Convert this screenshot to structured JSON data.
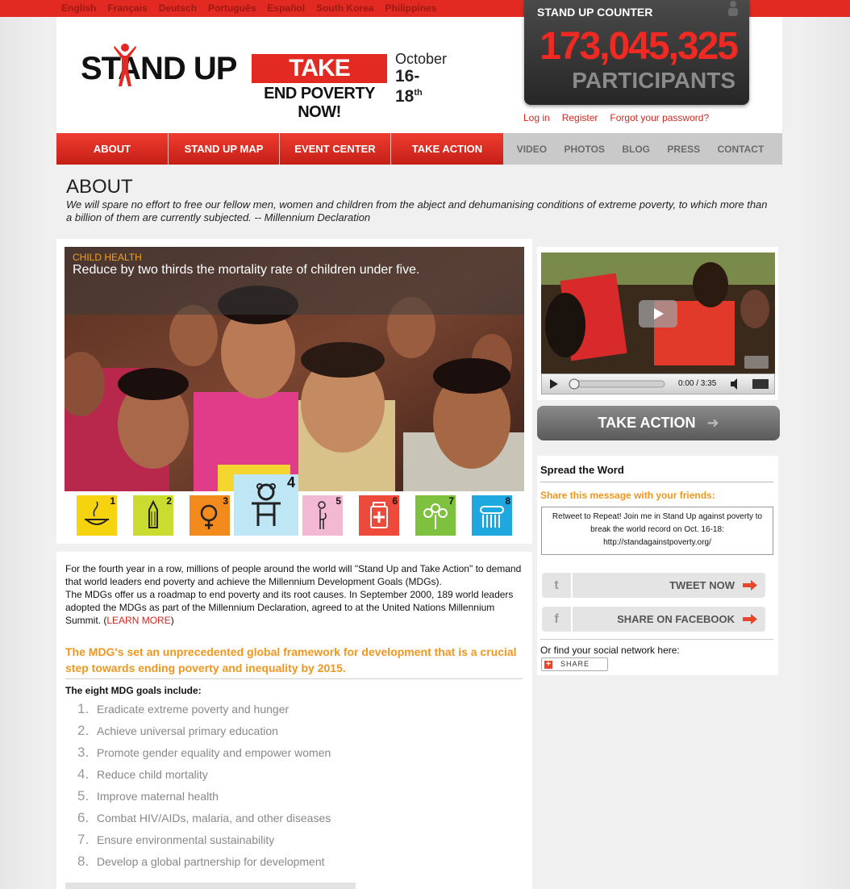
{
  "languages": [
    "English",
    "Français",
    "Deutsch",
    "Português",
    "Español",
    "South Korea",
    "Philippines"
  ],
  "logo": {
    "stand_up": "STAND UP",
    "take_action": "TAKE ACTION",
    "end_poverty": "END POVERTY NOW!",
    "month": "October",
    "dates": "16-18",
    "dates_suffix": "th"
  },
  "counter": {
    "title": "STAND UP COUNTER",
    "number": "173,045,325",
    "label": "PARTICIPANTS"
  },
  "auth": [
    "Log in",
    "Register",
    "Forgot your password?"
  ],
  "nav": {
    "primary": [
      "ABOUT",
      "STAND UP MAP",
      "EVENT CENTER",
      "TAKE ACTION"
    ],
    "secondary": [
      "VIDEO",
      "PHOTOS",
      "BLOG",
      "PRESS",
      "CONTACT"
    ]
  },
  "about": {
    "title": "ABOUT",
    "quote": "We will spare no effort to free our fellow men, women and children from the abject and dehumanising conditions of extreme poverty, to which more than a billion of them are currently subjected. -- Millennium Declaration"
  },
  "hero": {
    "category": "CHILD HEALTH",
    "caption": "Reduce by two thirds the mortality rate of children under five."
  },
  "goal_icons": [
    {
      "num": "1",
      "color": "#f5d40f",
      "icon": "bowl-icon"
    },
    {
      "num": "2",
      "color": "#c9dc2f",
      "icon": "pencil-icon"
    },
    {
      "num": "3",
      "color": "#f28a1e",
      "icon": "gender-icon"
    },
    {
      "num": "4",
      "color": "#bfe6f5",
      "icon": "child-icon"
    },
    {
      "num": "5",
      "color": "#f4b9d2",
      "icon": "pregnant-icon"
    },
    {
      "num": "6",
      "color": "#ee4a3c",
      "icon": "medicine-icon"
    },
    {
      "num": "7",
      "color": "#7ec13f",
      "icon": "plant-icon"
    },
    {
      "num": "8",
      "color": "#1fa8e0",
      "icon": "people-icon"
    }
  ],
  "intro": {
    "p1": "For the fourth year in a row, millions of people around the world will \"Stand Up and Take Action\" to demand that world leaders end poverty and achieve the Millennium Development Goals (MDGs).",
    "p2": "The MDGs offer us a roadmap to end poverty and its root causes. In September 2000, 189 world leaders adopted the MDGs as part of the Millennium Declaration, agreed to at the United Nations Millennium Summit. (",
    "learn_more": "LEARN MORE",
    "p2_end": ")"
  },
  "mdg_headline": "The MDG's set an unprecedented global framework for development that is a crucial step towards ending poverty and inequality by 2015.",
  "goals_heading": "The eight MDG goals include:",
  "goals": [
    {
      "n": "1.",
      "t": "Eradicate extreme poverty and hunger"
    },
    {
      "n": "2.",
      "t": "Achieve universal primary education"
    },
    {
      "n": "3.",
      "t": "Promote gender equality and empower women"
    },
    {
      "n": "4.",
      "t": "Reduce child mortality"
    },
    {
      "n": "5.",
      "t": "Improve maternal health"
    },
    {
      "n": "6.",
      "t": "Combat HIV/AIDs, malaria, and other diseases"
    },
    {
      "n": "7.",
      "t": "Ensure environmental sustainability"
    },
    {
      "n": "8.",
      "t": "Develop a global partnership for development"
    }
  ],
  "video": {
    "time": "0:00 / 3:35"
  },
  "take_action_button": "TAKE ACTION",
  "spread": {
    "title": "Spread the Word",
    "subtitle": "Share this message with your friends:",
    "tweet_text": "Retweet to Repeat! Join me in Stand Up against poverty to break the world record on Oct. 16-18: http://standagainstpoverty.org/",
    "tweet_button": "TWEET NOW",
    "facebook_button": "SHARE ON FACEBOOK",
    "find_text": "Or find your social network here:",
    "share_label": "SHARE"
  }
}
